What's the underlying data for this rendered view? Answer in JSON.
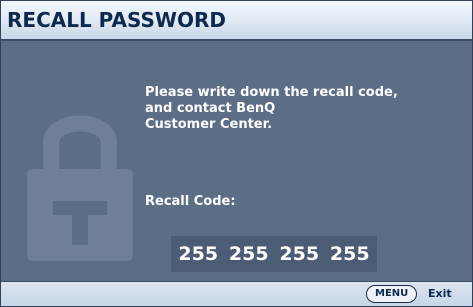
{
  "dialog": {
    "title": "RECALL PASSWORD",
    "message_lines": [
      "Please write down the recall code,",
      "and contact BenQ",
      "Customer Center."
    ],
    "recall_code_label": "Recall Code:",
    "recall_code": [
      "255",
      "255",
      "255",
      "255"
    ],
    "icon": "padlock-icon"
  },
  "footer": {
    "menu_key_label": "MENU",
    "exit_label": "Exit"
  },
  "colors": {
    "background": "#5c6d86",
    "title_text": "#0d2a4e",
    "body_text": "#ffffff",
    "code_box": "#4c5c74",
    "lock_watermark": "#6f7f98"
  }
}
